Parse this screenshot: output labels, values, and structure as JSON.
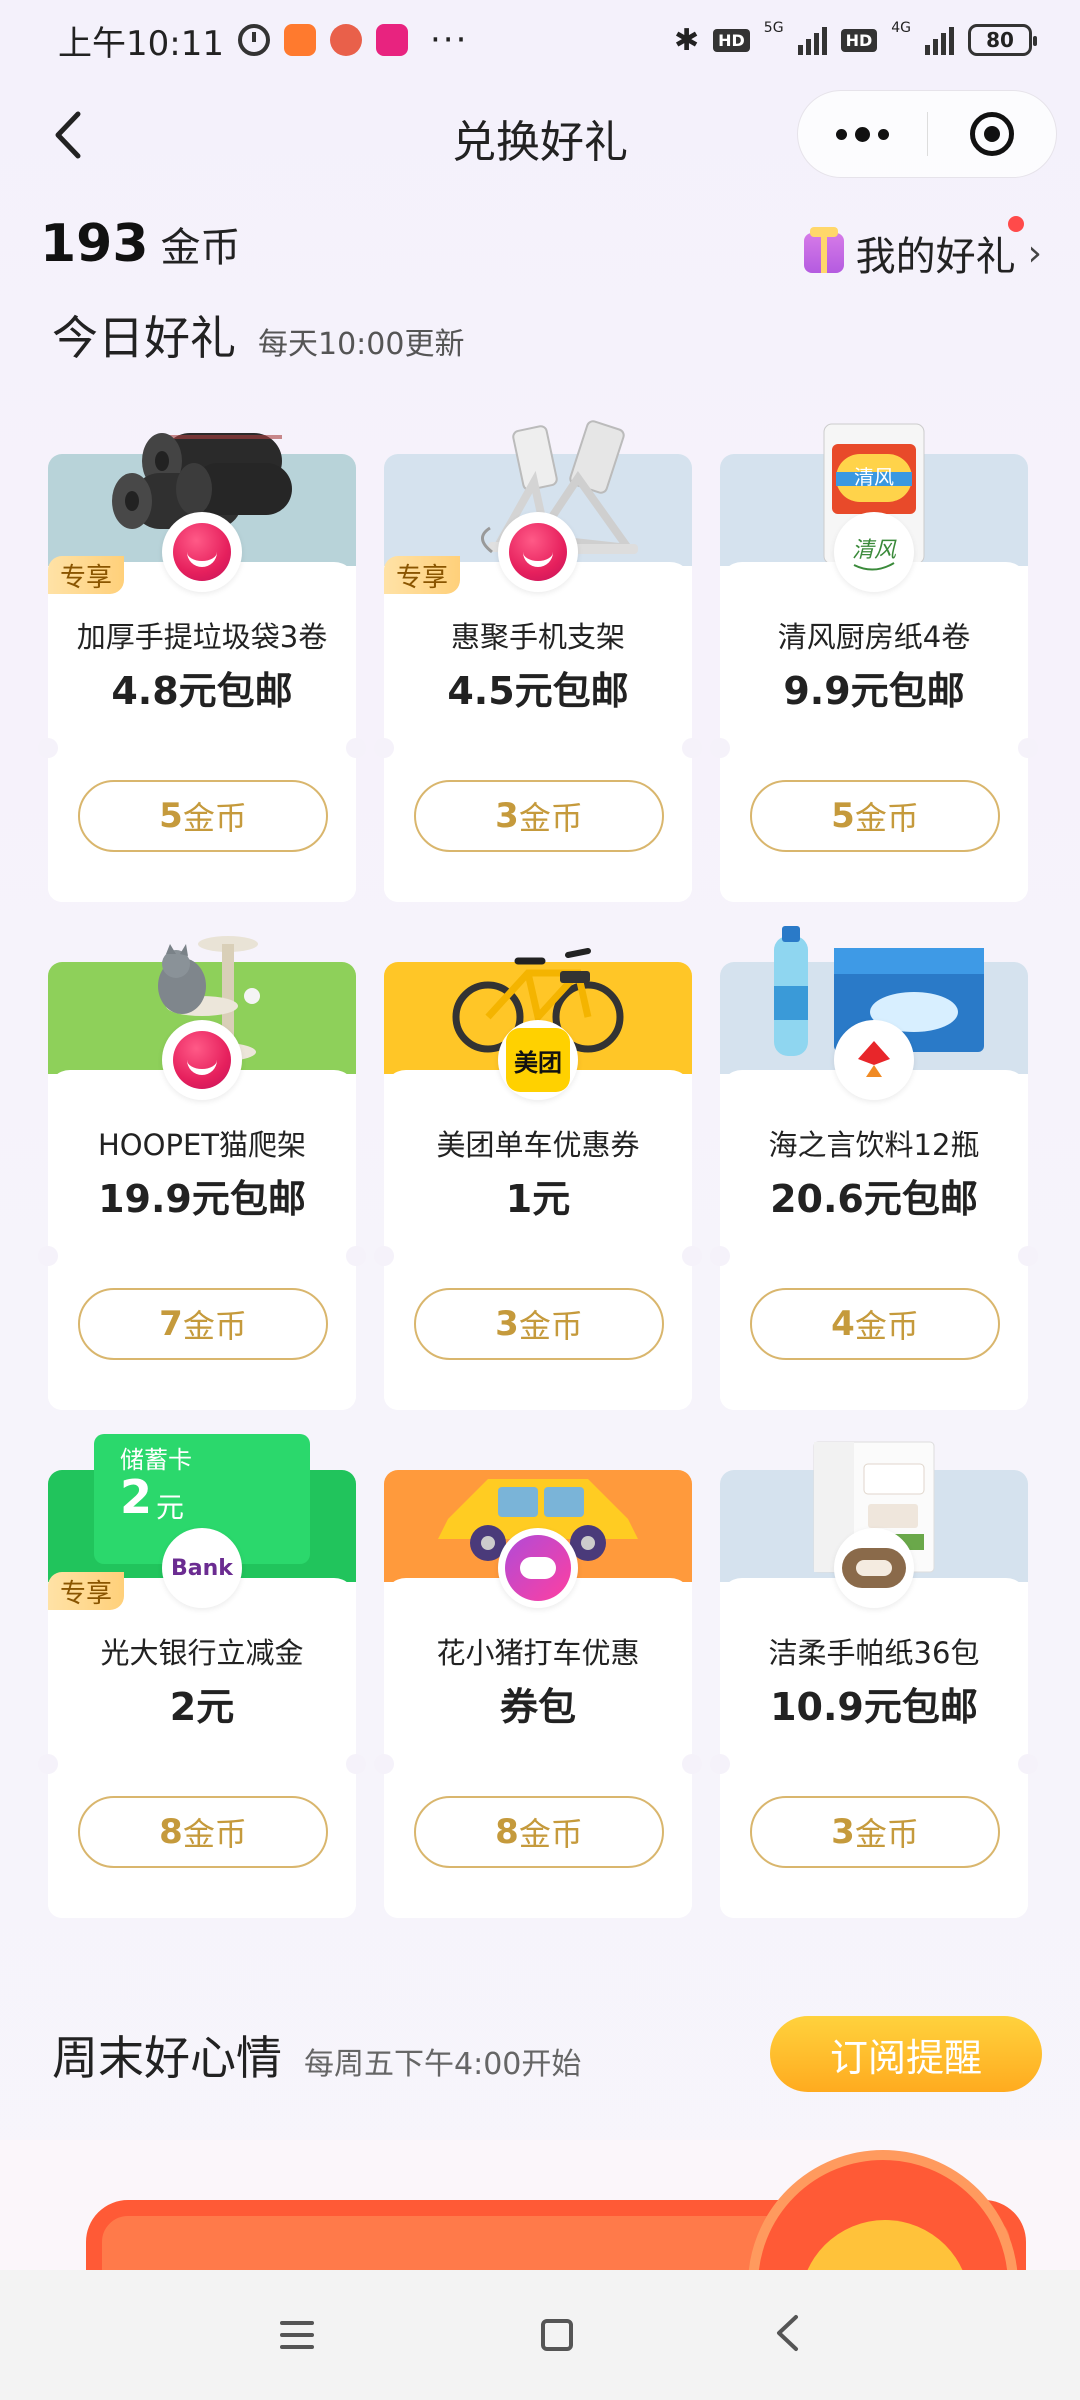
{
  "status_bar": {
    "time": "上午10:11",
    "dots": "···",
    "net_5g": "5G",
    "net_4g": "4G",
    "hd": "HD",
    "battery": "80"
  },
  "nav": {
    "title": "兑换好礼"
  },
  "header": {
    "coin_count": "193",
    "coin_unit": "金币",
    "my_gifts": "我的好礼",
    "section_title": "今日好礼",
    "section_sub": "每天10:00更新"
  },
  "cards": [
    {
      "name": "加厚手提垃圾袋3卷",
      "price": "4.8元包邮",
      "coins": "5",
      "coin_label": "金币",
      "tag": "专享",
      "top_color": "#b8d3d9"
    },
    {
      "name": "惠聚手机支架",
      "price": "4.5元包邮",
      "coins": "3",
      "coin_label": "金币",
      "tag": "专享",
      "top_color": "#d5e2ee"
    },
    {
      "name": "清风厨房纸4卷",
      "price": "9.9元包邮",
      "coins": "5",
      "coin_label": "金币",
      "tag": "",
      "top_color": "#d5e2ee"
    },
    {
      "name": "HOOPET猫爬架",
      "price": "19.9元包邮",
      "coins": "7",
      "coin_label": "金币",
      "tag": "",
      "top_color": "#8ed05a"
    },
    {
      "name": "美团单车优惠券",
      "price": "1元",
      "coins": "3",
      "coin_label": "金币",
      "tag": "",
      "top_color": "#ffc627"
    },
    {
      "name": "海之言饮料12瓶",
      "price": "20.6元包邮",
      "coins": "4",
      "coin_label": "金币",
      "tag": "",
      "top_color": "#d5e2ee"
    },
    {
      "name": "光大银行立减金",
      "price": "2元",
      "coins": "8",
      "coin_label": "金币",
      "tag": "专享",
      "top_color": "#21c45c",
      "voucher_label": "储蓄卡",
      "voucher_value": "2",
      "voucher_unit": "元"
    },
    {
      "name": "花小猪打车优惠",
      "price": "券包",
      "coins": "8",
      "coin_label": "金币",
      "tag": "",
      "top_color": "#ff9a3c"
    },
    {
      "name": "洁柔手帕纸36包",
      "price": "10.9元包邮",
      "coins": "3",
      "coin_label": "金币",
      "tag": "",
      "top_color": "#d5e2ee"
    }
  ],
  "logos": {
    "meituan": "美团",
    "bank": "Bank"
  },
  "weekend": {
    "title": "周末好心情",
    "sub": "每周五下午4:00开始",
    "subscribe": "订阅提醒"
  }
}
